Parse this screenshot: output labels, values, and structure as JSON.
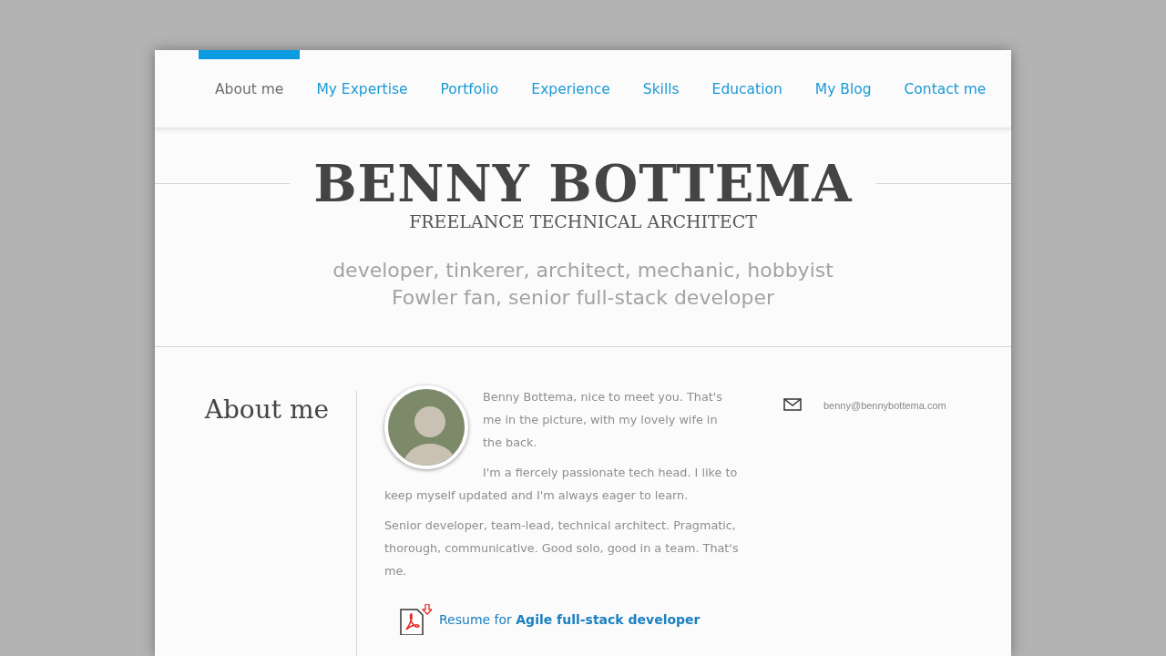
{
  "nav": [
    {
      "label": "About me",
      "selected": true
    },
    {
      "label": "My Expertise",
      "selected": false
    },
    {
      "label": "Portfolio",
      "selected": false
    },
    {
      "label": "Experience",
      "selected": false
    },
    {
      "label": "Skills",
      "selected": false
    },
    {
      "label": "Education",
      "selected": false
    },
    {
      "label": "My Blog",
      "selected": false
    },
    {
      "label": "Contact me",
      "selected": false
    }
  ],
  "header": {
    "name": "BENNY BOTTEMA",
    "role": "FREELANCE TECHNICAL ARCHITECT",
    "taglines": [
      "developer, tinkerer, architect, mechanic, hobbyist",
      "Fowler fan, senior full-stack developer"
    ]
  },
  "section": {
    "title": "About me",
    "paragraphs": [
      "Benny Bottema, nice to meet you. That's me in the picture, with my lovely wife in the back.",
      "I'm a fiercely passionate tech head. I like to keep myself updated and I'm always eager to learn.",
      "Senior developer, team-lead, technical architect. Pragmatic, thorough, communicative. Good solo, good in a team. That's me."
    ],
    "resume_link": "Resume for **Agile full-stack developer**",
    "email": "benny@bennybottema.com"
  }
}
